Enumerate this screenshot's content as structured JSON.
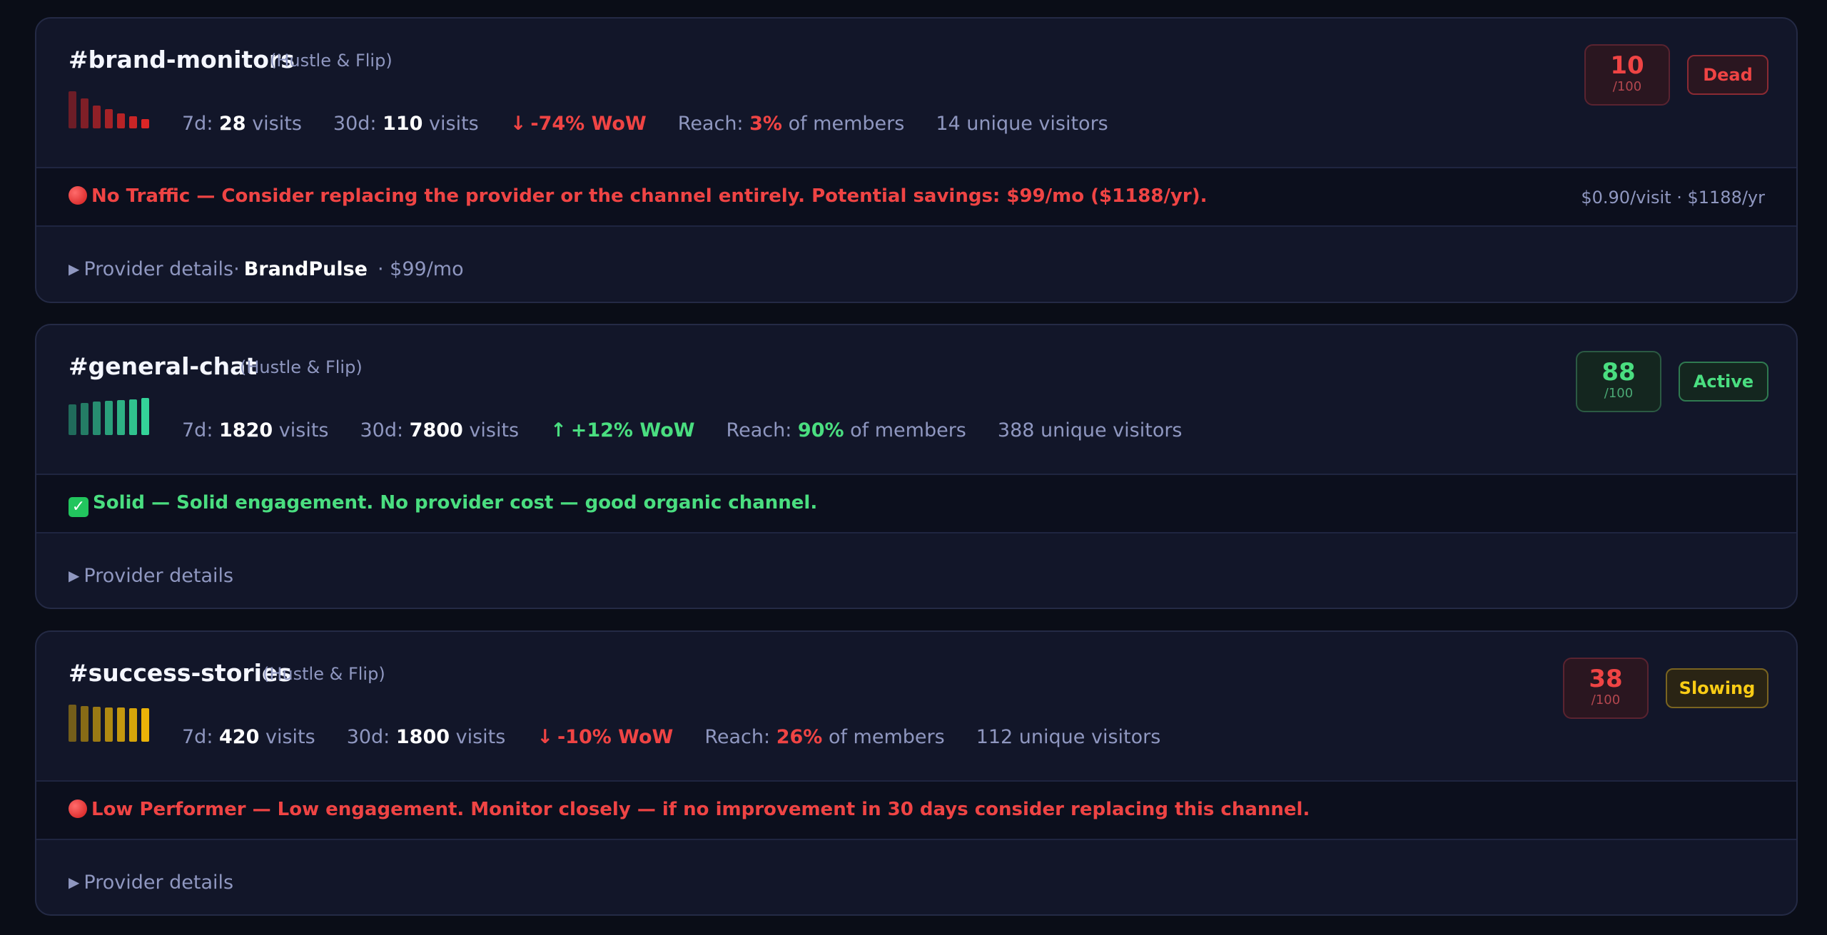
{
  "channels": [
    {
      "name": "#brand-monitors",
      "server": "(Hustle & Flip)",
      "stats": {
        "d7_label": "7d:",
        "d7_value": "28",
        "d7_unit": "visits",
        "d30_label": "30d:",
        "d30_value": "110",
        "d30_unit": "visits",
        "wow_arrow": "↓",
        "wow": "-74% WoW",
        "reach_label": "Reach:",
        "reach_value": "3%",
        "reach_suffix": "of members",
        "unique": "14 unique visitors"
      },
      "score": "10",
      "score_denom": "/100",
      "status": "Dead",
      "alert_prefix": "No Traffic",
      "alert_body": " — Consider replacing the provider or the channel entirely. Potential savings: $99/mo ($1188/yr).",
      "cost_summary": "$0.90/visit · $1188/yr",
      "provider_label": "Provider details",
      "provider_sep": "·",
      "provider_name": "BrandPulse",
      "provider_price": "· $99/mo",
      "sparkline": [
        1.0,
        0.8,
        0.62,
        0.52,
        0.4,
        0.32,
        0.25
      ],
      "sparkline_color": "#dc2626",
      "color_accent": "#ef4444"
    },
    {
      "name": "#general-chat",
      "server": "(Hustle & Flip)",
      "stats": {
        "d7_label": "7d:",
        "d7_value": "1820",
        "d7_unit": "visits",
        "d30_label": "30d:",
        "d30_value": "7800",
        "d30_unit": "visits",
        "wow_arrow": "↑",
        "wow": "+12% WoW",
        "reach_label": "Reach:",
        "reach_value": "90%",
        "reach_suffix": "of members",
        "unique": "388 unique visitors"
      },
      "score": "88",
      "score_denom": "/100",
      "status": "Active",
      "alert_prefix": "Solid",
      "alert_body": " — Solid engagement. No provider cost — good organic channel.",
      "provider_label": "Provider details",
      "sparkline": [
        0.82,
        0.86,
        0.9,
        0.92,
        0.94,
        0.97,
        1.0
      ],
      "sparkline_color": "#34d399",
      "color_accent": "#4ade80"
    },
    {
      "name": "#success-stories",
      "server": "(Hustle & Flip)",
      "stats": {
        "d7_label": "7d:",
        "d7_value": "420",
        "d7_unit": "visits",
        "d30_label": "30d:",
        "d30_value": "1800",
        "d30_unit": "visits",
        "wow_arrow": "↓",
        "wow": "-10% WoW",
        "reach_label": "Reach:",
        "reach_value": "26%",
        "reach_suffix": "of members",
        "unique": "112 unique visitors"
      },
      "score": "38",
      "score_denom": "/100",
      "status": "Slowing",
      "alert_prefix": "Low Performer",
      "alert_body": " — Low engagement. Monitor closely — if no improvement in 30 days consider replacing this channel.",
      "provider_label": "Provider details",
      "sparkline": [
        1.0,
        0.97,
        0.95,
        0.93,
        0.92,
        0.9,
        0.9
      ],
      "sparkline_color": "#eab308",
      "color_accent": "#facc15"
    }
  ]
}
